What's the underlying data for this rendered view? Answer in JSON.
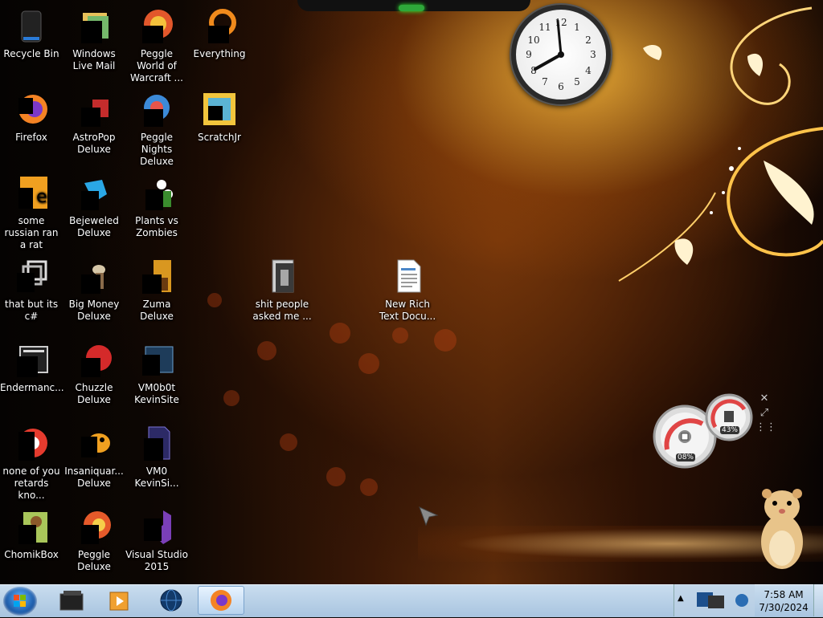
{
  "desktop": {
    "icons": [
      {
        "label": "Recycle Bin",
        "icon": "recycle-bin-icon"
      },
      {
        "label": "Windows Live Mail",
        "icon": "windows-live-mail-icon"
      },
      {
        "label": "Peggle World of Warcraft ...",
        "icon": "peggle-wow-icon"
      },
      {
        "label": "Everything",
        "icon": "everything-icon"
      },
      {
        "label": "Firefox",
        "icon": "firefox-icon"
      },
      {
        "label": "AstroPop Deluxe",
        "icon": "astropop-icon"
      },
      {
        "label": "Peggle Nights Deluxe",
        "icon": "peggle-nights-icon"
      },
      {
        "label": "ScratchJr",
        "icon": "scratchjr-icon"
      },
      {
        "label": "some russian ran a rat",
        "icon": "java-file-icon"
      },
      {
        "label": "Bejeweled Deluxe",
        "icon": "bejeweled-icon"
      },
      {
        "label": "Plants vs Zombies",
        "icon": "plants-vs-zombies-icon"
      },
      {
        "label": "that but its c#",
        "icon": "shortcut-icon"
      },
      {
        "label": "Big Money Deluxe",
        "icon": "big-money-icon"
      },
      {
        "label": "Zuma Deluxe",
        "icon": "zuma-icon"
      },
      {
        "label": "shit people asked me ...",
        "icon": "folder-icon"
      },
      {
        "label": "New Rich Text Docu...",
        "icon": "rich-text-document-icon"
      },
      {
        "label": "Endermanc...",
        "icon": "app-window-icon"
      },
      {
        "label": "Chuzzle Deluxe",
        "icon": "chuzzle-icon"
      },
      {
        "label": "VM0b0t KevinSite",
        "icon": "vm-icon"
      },
      {
        "label": "none of you retards kno...",
        "icon": "chrome-icon"
      },
      {
        "label": "Insaniquar... Deluxe",
        "icon": "insaniquarium-icon"
      },
      {
        "label": "VM0 KevinSi...",
        "icon": "vm-file-icon"
      },
      {
        "label": "ChomikBox",
        "icon": "chomikbox-icon"
      },
      {
        "label": "Peggle Deluxe",
        "icon": "peggle-icon"
      },
      {
        "label": "Visual Studio 2015",
        "icon": "visual-studio-icon"
      }
    ]
  },
  "clock": {
    "numbers": [
      "12",
      "1",
      "2",
      "3",
      "4",
      "5",
      "6",
      "7",
      "8",
      "9",
      "10",
      "11"
    ],
    "time": "7:58"
  },
  "cpu_meter": {
    "cpu_percent": "08%",
    "memory_percent": "43%"
  },
  "taskbar": {
    "start": "start-orb-icon",
    "pinned": [
      "terminal-icon",
      "media-player-icon",
      "globe-icon",
      "firefox-icon"
    ],
    "clock_time": "7:58 AM",
    "clock_date": "7/30/2024"
  },
  "colors": {
    "taskbar": "#b7cfe6",
    "wallpaper_accent": "#f5b340"
  }
}
